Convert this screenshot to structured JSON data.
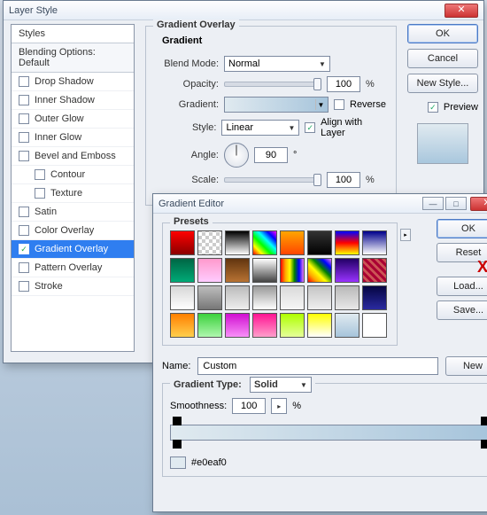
{
  "layer_style": {
    "title": "Layer Style",
    "styles_header": "Styles",
    "blending_label": "Blending Options: Default",
    "items": [
      {
        "label": "Drop Shadow",
        "checked": false
      },
      {
        "label": "Inner Shadow",
        "checked": false
      },
      {
        "label": "Outer Glow",
        "checked": false
      },
      {
        "label": "Inner Glow",
        "checked": false
      },
      {
        "label": "Bevel and Emboss",
        "checked": false
      },
      {
        "label": "Contour",
        "checked": false,
        "indent": true
      },
      {
        "label": "Texture",
        "checked": false,
        "indent": true
      },
      {
        "label": "Satin",
        "checked": false
      },
      {
        "label": "Color Overlay",
        "checked": false
      },
      {
        "label": "Gradient Overlay",
        "checked": true,
        "selected": true
      },
      {
        "label": "Pattern Overlay",
        "checked": false
      },
      {
        "label": "Stroke",
        "checked": false
      }
    ],
    "overlay": {
      "group": "Gradient Overlay",
      "sub": "Gradient",
      "blend_mode_label": "Blend Mode:",
      "blend_mode": "Normal",
      "opacity_label": "Opacity:",
      "opacity": "100",
      "gradient_label": "Gradient:",
      "reverse_label": "Reverse",
      "style_label": "Style:",
      "style": "Linear",
      "align_label": "Align with Layer",
      "angle_label": "Angle:",
      "angle": "90",
      "deg": "°",
      "scale_label": "Scale:",
      "scale": "100",
      "pct": "%"
    },
    "buttons": {
      "ok": "OK",
      "cancel": "Cancel",
      "new_style": "New Style...",
      "preview": "Preview"
    }
  },
  "gradient_editor": {
    "title": "Gradient Editor",
    "presets_label": "Presets",
    "ok": "OK",
    "reset": "Reset",
    "load": "Load...",
    "save": "Save...",
    "name_label": "Name:",
    "name": "Custom",
    "new_btn": "New",
    "gtype_label": "Gradient Type:",
    "gtype": "Solid",
    "smooth_label": "Smoothness:",
    "smooth": "100",
    "pct": "%",
    "hex": "#e0eaf0",
    "xx": "XX",
    "swatches": [
      "linear-gradient(red,darkred)",
      "repeating-conic-gradient(#ccc 0 25%,#fff 0 50%) 0/8px 8px",
      "linear-gradient(#000,#fff)",
      "linear-gradient(45deg,#f00,#ff0,#0f0,#0ff,#00f,#f0f)",
      "linear-gradient(#ffa500,#ff4500)",
      "linear-gradient(#333,#000)",
      "linear-gradient(#00f,#f00,#ff0)",
      "linear-gradient(#00008b,#fff)",
      "linear-gradient(#064,#0a7)",
      "linear-gradient(#f9c,#fcf)",
      "linear-gradient(#62350f,#b87333)",
      "linear-gradient(#fff,#444)",
      "linear-gradient(90deg,red,orange,yellow,green,blue,violet)",
      "linear-gradient(45deg,red,orange,yellow,green,blue,violet)",
      "linear-gradient(#206,#93f)",
      "repeating-linear-gradient(45deg,#a03,#a03 3px,#c55 3px,#c55 6px)",
      "linear-gradient(#d7d7d7,#fff)",
      "linear-gradient(#bdbdbd,#777)",
      "linear-gradient(#bbb,#eee)",
      "linear-gradient(#999,#fff)",
      "linear-gradient(#dadada,#f6f6f6)",
      "linear-gradient(#c5c5c5,#efefef)",
      "linear-gradient(#b9b9b9,#e8e8e8)",
      "linear-gradient(#050542,#2a2aa0)",
      "linear-gradient(#ff7f00,#ffcf4d)",
      "linear-gradient(#3cd13c,#aef7ae)",
      "linear-gradient(#d10fd1,#f88ff8)",
      "linear-gradient(#ff1493,#ff9ecb)",
      "linear-gradient(#aeff00,#e6ff9a)",
      "linear-gradient(#ffff00,#fff)",
      "linear-gradient(#e0eaf0,#a6c4db)",
      "#fff"
    ]
  }
}
